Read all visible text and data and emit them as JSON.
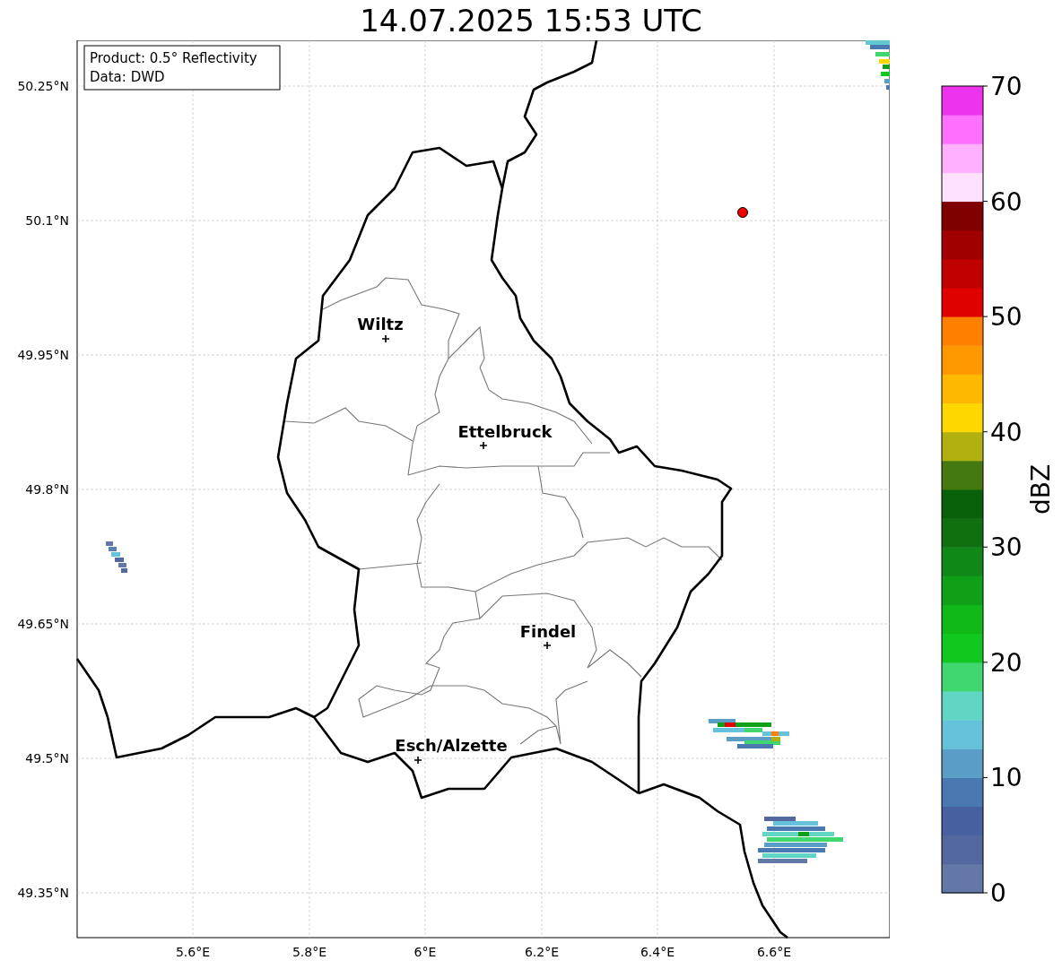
{
  "title": "14.07.2025 15:53 UTC",
  "info_box": [
    "Product: 0.5° Reflectivity",
    "Data: DWD"
  ],
  "cities": [
    {
      "name": "Wiltz"
    },
    {
      "name": "Ettelbruck"
    },
    {
      "name": "Findel"
    },
    {
      "name": "Esch/Alzette"
    }
  ],
  "y_ticks": [
    "50.25°N",
    "50.1°N",
    "49.95°N",
    "49.8°N",
    "49.65°N",
    "49.5°N",
    "49.35°N"
  ],
  "x_ticks": [
    "5.6°E",
    "5.8°E",
    "6°E",
    "6.2°E",
    "6.4°E",
    "6.6°E"
  ],
  "colorbar": {
    "label": "dBZ",
    "ticks": [
      "70",
      "60",
      "50",
      "40",
      "30",
      "20",
      "10",
      "0"
    ]
  }
}
